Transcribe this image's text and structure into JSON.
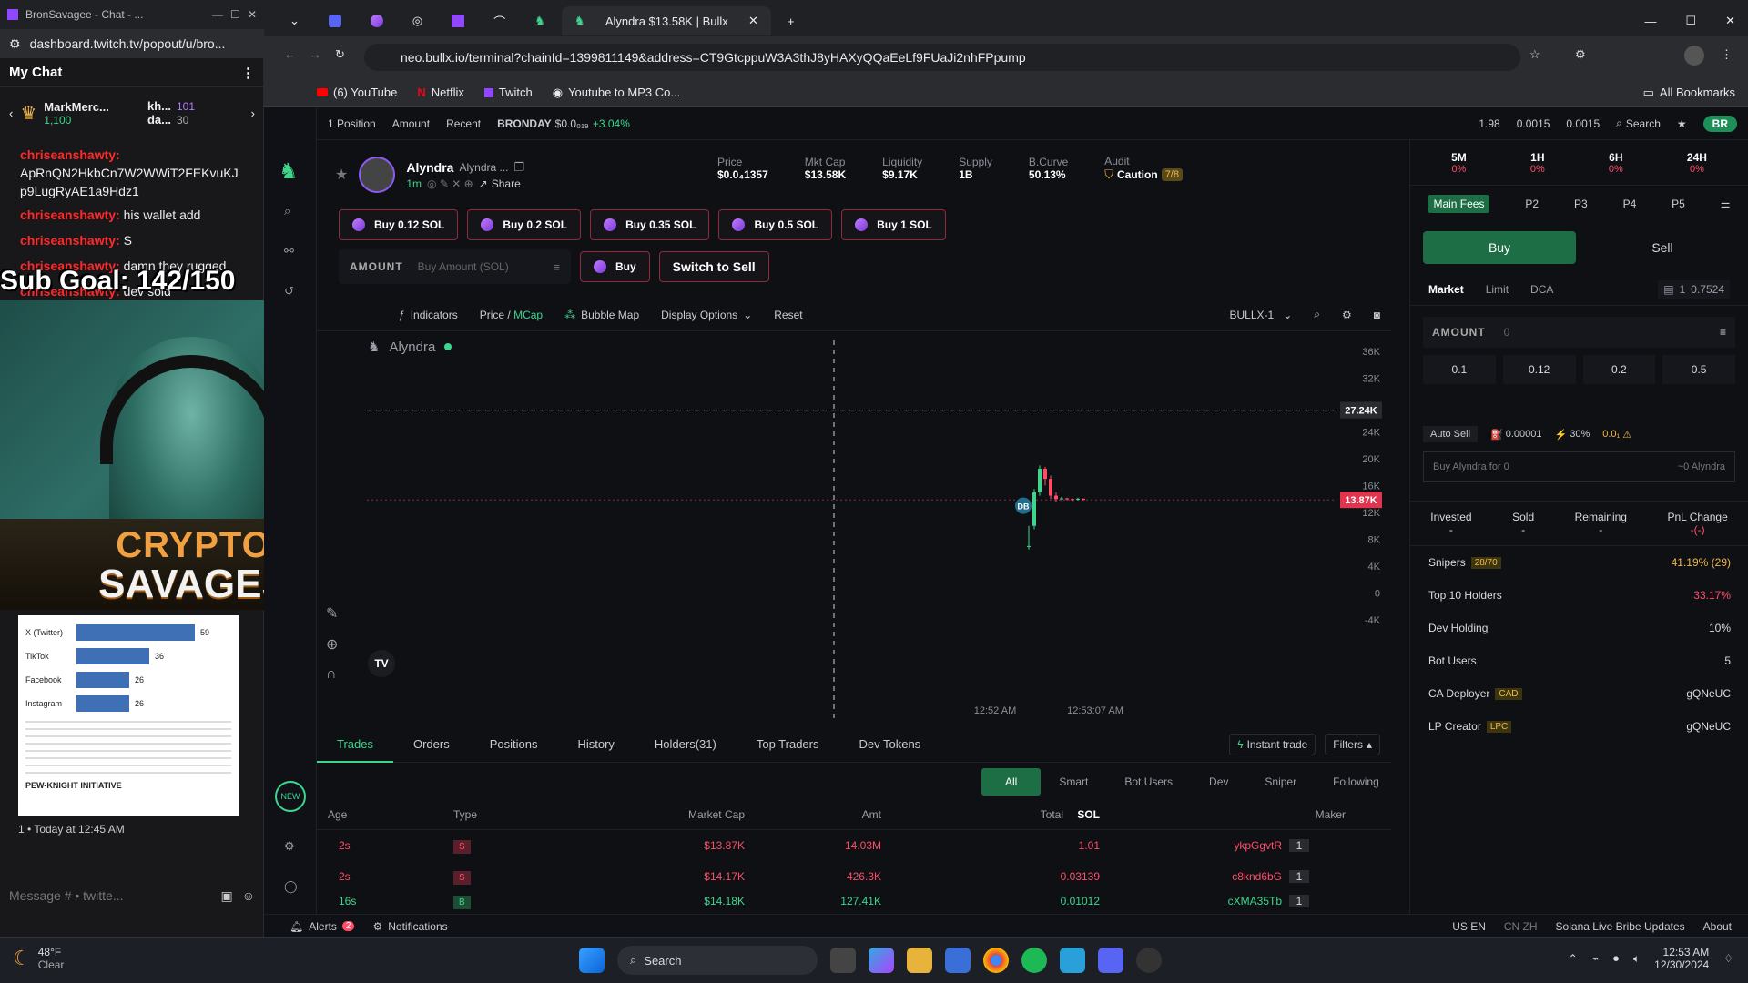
{
  "chat_window": {
    "tab_title": "BronSavagee - Chat - ...",
    "url": "dashboard.twitch.tv/popout/u/bro...",
    "header": "My Chat",
    "leader": [
      {
        "name": "MarkMerc...",
        "score": "1,100"
      },
      {
        "name": "kh...",
        "score": "101"
      },
      {
        "name": "da...",
        "score": "30"
      }
    ],
    "messages": [
      {
        "user": "chriseanshawty:",
        "text": "ApRnQN2HkbCn7W2WWiT2FEKvuKJp9LugRyAE1a9Hdz1"
      },
      {
        "user": "chriseanshawty:",
        "text": "his wallet add"
      },
      {
        "user": "chriseanshawty:",
        "text": "S"
      },
      {
        "user": "chriseanshawty:",
        "text": "damn they rugged"
      },
      {
        "user": "chriseanshawty:",
        "text": "dev sold"
      }
    ],
    "sub_goal": "Sub Goal: 142/150",
    "banner_line1": "CRYPTO",
    "banner_line2": "SAVAGES",
    "card": {
      "rows": [
        {
          "label": "X (Twitter)",
          "value": 59
        },
        {
          "label": "TikTok",
          "value": 36
        },
        {
          "label": "Facebook",
          "value": 26
        },
        {
          "label": "Instagram",
          "value": 26
        }
      ],
      "footer": "PEW-KNIGHT INITIATIVE"
    },
    "timestamp": "1 • Today at 12:45 AM",
    "input_placeholder": "Message # • twitte..."
  },
  "browser": {
    "tab_title": "Alyndra $13.58K | Bullx",
    "url": "neo.bullx.io/terminal?chainId=1399811149&address=CT9GtcppuW3A3thJ8yHAXyQQaEeLf9FUaJi2nhFPpump",
    "bookmarks": [
      "(6) YouTube",
      "Netflix",
      "Twitch",
      "Youtube to MP3 Co..."
    ],
    "all_bookmarks": "All Bookmarks"
  },
  "topstrip": {
    "position": "1 Position",
    "amount": "Amount",
    "recent": "Recent",
    "ticker": "BRONDAY",
    "ticker_price": "$0.0₀₁₉",
    "ticker_change": "+3.04%",
    "stat1": "1.98",
    "stat2": "0.0015",
    "stat3": "0.0015",
    "search": "Search",
    "badge": "BR"
  },
  "token": {
    "name": "Alyndra",
    "subname": "Alyndra ...",
    "age": "1m",
    "share": "Share",
    "stats": [
      {
        "label": "Price",
        "value": "$0.0₄1357"
      },
      {
        "label": "Mkt Cap",
        "value": "$13.58K"
      },
      {
        "label": "Liquidity",
        "value": "$9.17K"
      },
      {
        "label": "Supply",
        "value": "1B"
      },
      {
        "label": "B.Curve",
        "value": "50.13%"
      },
      {
        "label": "Audit",
        "value": "Caution",
        "extra": "7/8"
      }
    ]
  },
  "quickbuy": [
    "Buy 0.12 SOL",
    "Buy 0.2 SOL",
    "Buy 0.35 SOL",
    "Buy 0.5 SOL",
    "Buy 1 SOL"
  ],
  "amount_row": {
    "label": "AMOUNT",
    "placeholder": "Buy Amount (SOL)",
    "buy": "Buy",
    "switch": "Switch to Sell"
  },
  "chart_toolbar": {
    "indicators": "Indicators",
    "price": "Price",
    "mcap": "MCap",
    "bubble": "Bubble Map",
    "display": "Display Options",
    "reset": "Reset",
    "bullx": "BULLX-1"
  },
  "chart_data": {
    "type": "candlestick",
    "title": "Alyndra",
    "y_ticks": [
      "36K",
      "32K",
      "28K",
      "24K",
      "20K",
      "16K",
      "12K",
      "8K",
      "4K",
      "0",
      "-4K"
    ],
    "crosshair_label": "27.24K",
    "last_price_label": "13.87K",
    "x_ticks": [
      "12:52 AM",
      "12:53:07 AM"
    ],
    "marker": "DB"
  },
  "bottom_tabs": [
    "Trades",
    "Orders",
    "Positions",
    "History",
    "Holders(31)",
    "Top Traders",
    "Dev Tokens"
  ],
  "instant_trade": "Instant trade",
  "filters": "Filters",
  "filter_tabs": [
    "All",
    "Smart",
    "Bot Users",
    "Dev",
    "Sniper",
    "Following"
  ],
  "table": {
    "headers": [
      "Age",
      "Type",
      "Market Cap",
      "Amt",
      "Total",
      "SOL",
      "Maker"
    ],
    "rows": [
      {
        "age": "2s",
        "type": "S",
        "mcap": "$13.87K",
        "amt": "14.03M",
        "total": "1.01",
        "maker": "ykpGgvtR",
        "n": "1"
      },
      {
        "age": "2s",
        "type": "S",
        "mcap": "$14.17K",
        "amt": "426.3K",
        "total": "0.03139",
        "maker": "c8knd6bG",
        "n": "1"
      },
      {
        "age": "16s",
        "type": "B",
        "mcap": "$14.18K",
        "amt": "127.41K",
        "total": "0.01012",
        "maker": "cXMA35Tb",
        "n": "1"
      }
    ]
  },
  "right_panel": {
    "timeframes": [
      {
        "label": "5M",
        "value": "0%"
      },
      {
        "label": "1H",
        "value": "0%"
      },
      {
        "label": "6H",
        "value": "0%"
      },
      {
        "label": "24H",
        "value": "0%"
      }
    ],
    "presets": [
      "Main Fees",
      "P2",
      "P3",
      "P4",
      "P5"
    ],
    "buy": "Buy",
    "sell": "Sell",
    "order_tabs": [
      "Market",
      "Limit",
      "DCA"
    ],
    "wallet": "1",
    "wallet_val": "0.7524",
    "amount_label": "AMOUNT",
    "amount_val": "0",
    "amounts": [
      "0.1",
      "0.12",
      "0.2",
      "0.5"
    ],
    "auto_sell": "Auto Sell",
    "fee": "0.00001",
    "slip": "30%",
    "prio": "0.0₁",
    "buy_for": "Buy Alyndra for 0",
    "receive": "~0 Alyndra",
    "pnl": [
      {
        "label": "Invested",
        "value": "-"
      },
      {
        "label": "Sold",
        "value": "-"
      },
      {
        "label": "Remaining",
        "value": "-"
      },
      {
        "label": "PnL Change",
        "value": "-(-)"
      }
    ],
    "stats": [
      {
        "label": "Snipers",
        "badge": "28/70",
        "value": "41.19% (29)"
      },
      {
        "label": "Top 10 Holders",
        "value": "33.17%"
      },
      {
        "label": "Dev Holding",
        "value": "10%"
      },
      {
        "label": "Bot Users",
        "value": "5"
      },
      {
        "label": "CA Deployer",
        "badge": "CAD",
        "value": "gQNeUC"
      },
      {
        "label": "LP Creator",
        "badge": "LPC",
        "value": "gQNeUC"
      }
    ]
  },
  "statusbar": {
    "alerts": "Alerts",
    "alerts_count": "2",
    "notifications": "Notifications",
    "lang1": "US EN",
    "lang2": "CN ZH",
    "news": "Solana Live Bribe Updates",
    "about": "About"
  },
  "taskbar": {
    "weather_temp": "48°F",
    "weather_desc": "Clear",
    "search": "Search",
    "time": "12:53 AM",
    "date": "12/30/2024"
  }
}
